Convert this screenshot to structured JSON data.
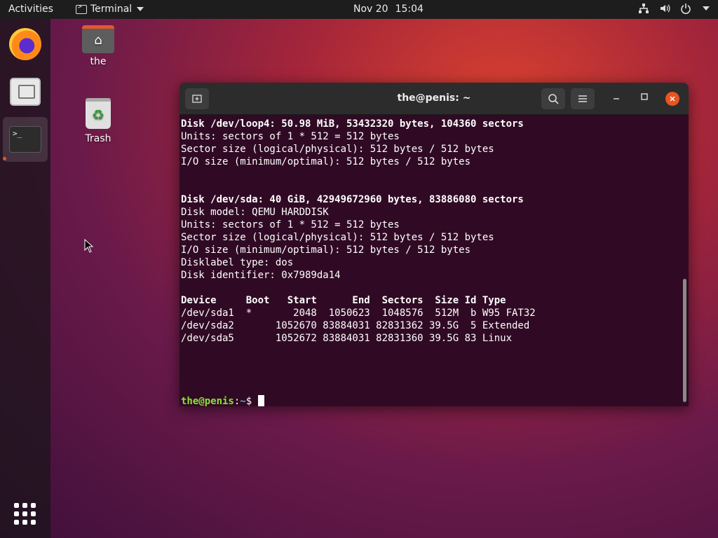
{
  "topbar": {
    "activities": "Activities",
    "app_name": "Terminal",
    "date": "Nov 20",
    "time": "15:04"
  },
  "desktop": {
    "home_label": "the",
    "trash_label": "Trash"
  },
  "terminal": {
    "title": "the@penis: ~",
    "lines": [
      {
        "text": "Disk /dev/loop4: 50.98 MiB, 53432320 bytes, 104360 sectors",
        "bold": true
      },
      {
        "text": "Units: sectors of 1 * 512 = 512 bytes",
        "bold": false
      },
      {
        "text": "Sector size (logical/physical): 512 bytes / 512 bytes",
        "bold": false
      },
      {
        "text": "I/O size (minimum/optimal): 512 bytes / 512 bytes",
        "bold": false
      },
      {
        "text": "",
        "bold": false
      },
      {
        "text": "",
        "bold": false
      },
      {
        "text": "Disk /dev/sda: 40 GiB, 42949672960 bytes, 83886080 sectors",
        "bold": true
      },
      {
        "text": "Disk model: QEMU HARDDISK",
        "bold": false
      },
      {
        "text": "Units: sectors of 1 * 512 = 512 bytes",
        "bold": false
      },
      {
        "text": "Sector size (logical/physical): 512 bytes / 512 bytes",
        "bold": false
      },
      {
        "text": "I/O size (minimum/optimal): 512 bytes / 512 bytes",
        "bold": false
      },
      {
        "text": "Disklabel type: dos",
        "bold": false
      },
      {
        "text": "Disk identifier: 0x7989da14",
        "bold": false
      },
      {
        "text": "",
        "bold": false
      },
      {
        "text": "Device     Boot   Start      End  Sectors  Size Id Type",
        "bold": true
      },
      {
        "text": "/dev/sda1  *       2048  1050623  1048576  512M  b W95 FAT32",
        "bold": false
      },
      {
        "text": "/dev/sda2       1052670 83884031 82831362 39.5G  5 Extended",
        "bold": false
      },
      {
        "text": "/dev/sda5       1052672 83884031 82831360 39.5G 83 Linux",
        "bold": false
      },
      {
        "text": "",
        "bold": false
      },
      {
        "text": "",
        "bold": false
      },
      {
        "text": "",
        "bold": false
      },
      {
        "text": "",
        "bold": false
      }
    ],
    "prompt": {
      "user_host": "the@penis",
      "sep": ":",
      "path": "~",
      "symbol": "$ "
    }
  },
  "colors": {
    "terminal_bg": "#300a24",
    "prompt_user": "#8ae234",
    "prompt_path": "#729fcf",
    "accent": "#e95420"
  }
}
